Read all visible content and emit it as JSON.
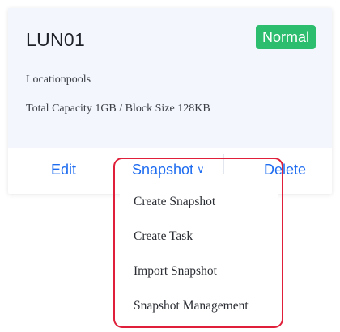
{
  "card": {
    "title": "LUN01",
    "status": "Normal",
    "location": "Locationpools",
    "capacity": "Total Capacity 1GB / Block Size 128KB"
  },
  "actions": {
    "edit": "Edit",
    "snapshot": "Snapshot",
    "delete": "Delete"
  },
  "dropdown": {
    "items": [
      {
        "label": "Create Snapshot"
      },
      {
        "label": "Create Task"
      },
      {
        "label": "Import Snapshot"
      },
      {
        "label": "Snapshot Management"
      }
    ]
  },
  "colors": {
    "accent": "#1e6cf0",
    "status_normal": "#2dbd6e",
    "highlight": "#e0203a"
  }
}
